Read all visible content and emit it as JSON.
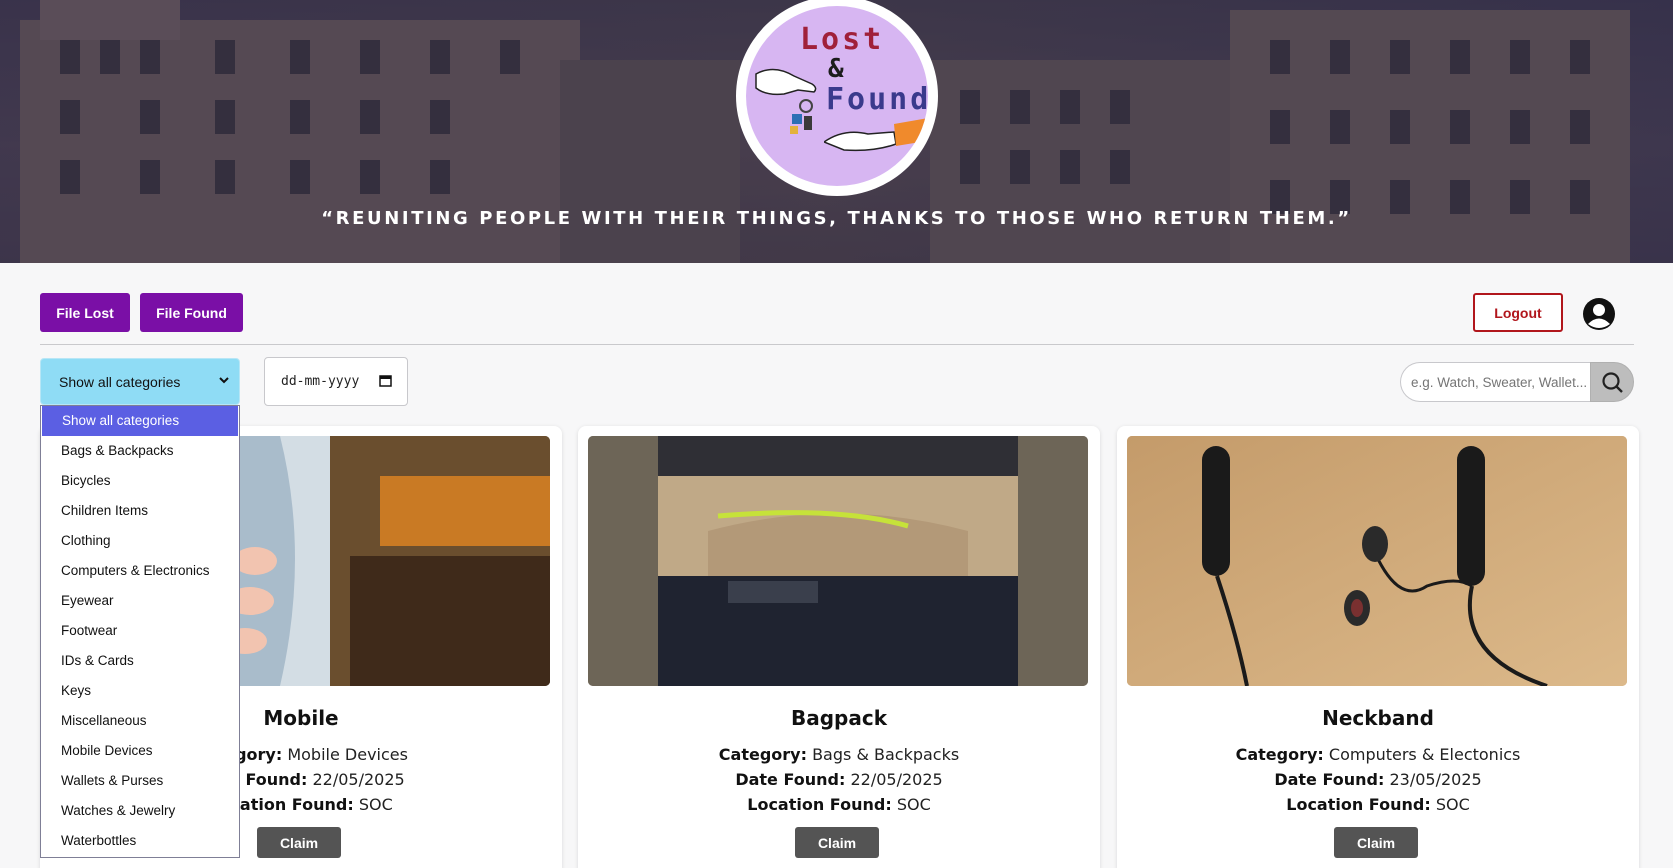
{
  "hero": {
    "logo_line1": "Lost",
    "logo_line2": "&",
    "logo_line3": "Found",
    "tagline": "“REUNITING PEOPLE WITH THEIR THINGS, THANKS TO THOSE WHO RETURN THEM.”"
  },
  "toolbar": {
    "file_lost_label": "File Lost",
    "file_found_label": "File Found",
    "logout_label": "Logout"
  },
  "filters": {
    "category_selected": "Show all categories",
    "category_options": [
      "Show all categories",
      "Bags & Backpacks",
      "Bicycles",
      "Children Items",
      "Clothing",
      "Computers & Electronics",
      "Eyewear",
      "Footwear",
      "IDs & Cards",
      "Keys",
      "Miscellaneous",
      "Mobile Devices",
      "Wallets & Purses",
      "Watches & Jewelry",
      "Waterbottles"
    ],
    "date_placeholder": "dd-mm-yyyy",
    "search_placeholder": "e.g. Watch, Sweater, Wallet..."
  },
  "labels": {
    "category": "Category:",
    "date_found": "Date Found:",
    "location_found": "Location Found:",
    "claim": "Claim"
  },
  "items": [
    {
      "title": "Mobile",
      "category": "Mobile Devices",
      "date_found": "22/05/2025",
      "location_found": "SOC"
    },
    {
      "title": "Bagpack",
      "category": "Bags & Backpacks",
      "date_found": "22/05/2025",
      "location_found": "SOC"
    },
    {
      "title": "Neckband",
      "category": "Computers & Electonics",
      "date_found": "23/05/2025",
      "location_found": "SOC"
    }
  ],
  "colors": {
    "primary_purple": "#7a0fa6",
    "logout_red": "#b1161c",
    "category_select_bg": "#8fdcf5",
    "dropdown_selected": "#5b5fe3",
    "claim_gray": "#545454"
  }
}
